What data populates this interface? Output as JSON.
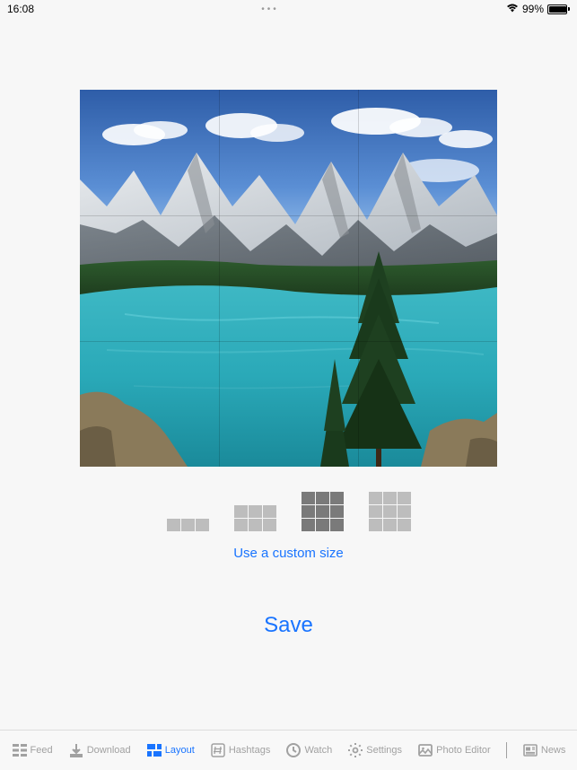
{
  "status": {
    "time": "16:08",
    "battery_percent": "99%"
  },
  "preview": {
    "grid_rows": 3,
    "grid_cols": 3
  },
  "layout": {
    "custom_label": "Use a custom size"
  },
  "actions": {
    "save": "Save"
  },
  "tabs": {
    "feed": "Feed",
    "download": "Download",
    "layout": "Layout",
    "hashtags": "Hashtags",
    "watch": "Watch",
    "settings": "Settings",
    "photo_editor": "Photo Editor",
    "news": "News"
  }
}
